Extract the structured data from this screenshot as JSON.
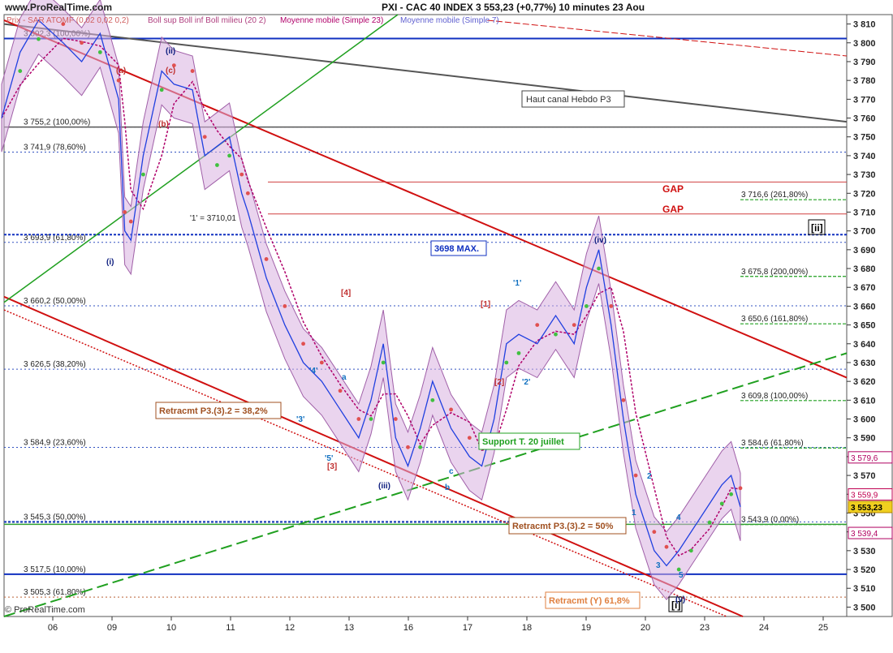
{
  "header": {
    "site": "www.ProRealTime.com",
    "title": "PXI - CAC 40 INDEX      3 553,23 (+0,77%)      10 minutes  23 Aou"
  },
  "legend": [
    {
      "text": "Prix - SAR ATOMF (0,02 0,02 0,2)",
      "color": "#d06060"
    },
    {
      "text": "Boll sup Boll inf Boll milieu (20 2)",
      "color": "#b04080"
    },
    {
      "text": "Moyenne mobile (Simple 23)",
      "color": "#b0006a"
    },
    {
      "text": "Moyenne mobile (Simple 7)",
      "color": "#6060d0"
    }
  ],
  "footer": "© ProRealTime.com",
  "chart_data": {
    "type": "line",
    "ylim": [
      3495,
      3815
    ],
    "y_ticks": [
      3500,
      3510,
      3520,
      3530,
      3540,
      3550,
      3560,
      3570,
      3580,
      3590,
      3600,
      3610,
      3620,
      3630,
      3640,
      3650,
      3660,
      3670,
      3680,
      3690,
      3700,
      3710,
      3720,
      3730,
      3740,
      3750,
      3760,
      3770,
      3780,
      3790,
      3800,
      3810
    ],
    "x_ticks": [
      "06",
      "09",
      "10",
      "11",
      "12",
      "13",
      "16",
      "17",
      "18",
      "19",
      "20",
      "23",
      "24",
      "25"
    ],
    "price_series": {
      "name": "PXI",
      "points": [
        [
          0.0,
          3760
        ],
        [
          0.3,
          3795
        ],
        [
          0.6,
          3812
        ],
        [
          1.0,
          3800
        ],
        [
          1.3,
          3790
        ],
        [
          1.6,
          3805
        ],
        [
          1.9,
          3770
        ],
        [
          2.0,
          3700
        ],
        [
          2.1,
          3695
        ],
        [
          2.3,
          3740
        ],
        [
          2.6,
          3785
        ],
        [
          2.8,
          3778
        ],
        [
          3.1,
          3775
        ],
        [
          3.3,
          3740
        ],
        [
          3.5,
          3745
        ],
        [
          3.7,
          3750
        ],
        [
          3.9,
          3720
        ],
        [
          4.0,
          3710
        ],
        [
          4.3,
          3675
        ],
        [
          4.6,
          3650
        ],
        [
          4.9,
          3630
        ],
        [
          5.2,
          3620
        ],
        [
          5.5,
          3605
        ],
        [
          5.8,
          3590
        ],
        [
          6.0,
          3610
        ],
        [
          6.2,
          3640
        ],
        [
          6.4,
          3590
        ],
        [
          6.6,
          3575
        ],
        [
          6.8,
          3595
        ],
        [
          7.0,
          3620
        ],
        [
          7.3,
          3595
        ],
        [
          7.6,
          3580
        ],
        [
          7.8,
          3575
        ],
        [
          8.0,
          3600
        ],
        [
          8.2,
          3640
        ],
        [
          8.4,
          3645
        ],
        [
          8.7,
          3640
        ],
        [
          9.0,
          3655
        ],
        [
          9.3,
          3640
        ],
        [
          9.5,
          3670
        ],
        [
          9.7,
          3690
        ],
        [
          9.9,
          3650
        ],
        [
          10.1,
          3600
        ],
        [
          10.3,
          3560
        ],
        [
          10.6,
          3530
        ],
        [
          10.8,
          3522
        ],
        [
          11.0,
          3530
        ],
        [
          11.2,
          3540
        ],
        [
          11.5,
          3555
        ],
        [
          11.7,
          3565
        ],
        [
          11.85,
          3570
        ],
        [
          12.0,
          3553.23
        ]
      ]
    },
    "current_price": "3 553,23",
    "right_labels": [
      {
        "text": "3 579,6",
        "y": 3579.6,
        "color": "#b00060"
      },
      {
        "text": "3 559,9",
        "y": 3559.9,
        "color": "#c00050"
      },
      {
        "text": "3 553,23",
        "y": 3553.23,
        "color": "#b08000"
      },
      {
        "text": "3 539,4",
        "y": 3539.4,
        "color": "#b00060"
      }
    ],
    "fib_levels": [
      {
        "label": "3 802,3 (100,00%)",
        "y": 3802.3,
        "side": "left"
      },
      {
        "label": "3 755,2 (100,00%)",
        "y": 3755.2,
        "side": "left"
      },
      {
        "label": "3 741,9 (78,60%)",
        "y": 3741.9,
        "side": "left"
      },
      {
        "label": "3 693,9 (61,80%)",
        "y": 3693.9,
        "side": "left"
      },
      {
        "label": "3 660,2 (50,00%)",
        "y": 3660.2,
        "side": "left"
      },
      {
        "label": "3 626,5 (38,20%)",
        "y": 3626.5,
        "side": "left"
      },
      {
        "label": "3 584,9 (23,60%)",
        "y": 3584.9,
        "side": "left"
      },
      {
        "label": "3 545,3 (50,00%)",
        "y": 3545.3,
        "side": "left"
      },
      {
        "label": "3 517,5 (10,00%)",
        "y": 3517.5,
        "side": "left"
      },
      {
        "label": "3 505,3 (61,80%)",
        "y": 3505.3,
        "side": "left"
      },
      {
        "label": "3 716,6 (261,80%)",
        "y": 3716.6,
        "side": "right"
      },
      {
        "label": "3 675,8 (200,00%)",
        "y": 3675.8,
        "side": "right"
      },
      {
        "label": "3 650,6 (161,80%)",
        "y": 3650.6,
        "side": "right"
      },
      {
        "label": "3 609,8 (100,00%)",
        "y": 3609.8,
        "side": "right"
      },
      {
        "label": "3 584,6 (61,80%)",
        "y": 3584.6,
        "side": "right"
      },
      {
        "label": "3 543,9 (0,00%)",
        "y": 3543.9,
        "side": "right"
      }
    ],
    "annotations": {
      "haut_canal": "Haut canal Hebdo P3",
      "gap1": "GAP",
      "gap2": "GAP",
      "max_box": "3698 MAX.",
      "retr_382": "Retracmt P3.(3).2 = 38,2%",
      "retr_50": "Retracmt P3.(3).2 = 50%",
      "support": "Support T. 20 juillet",
      "retr_y": "Retracmt (Y) 61,8%",
      "level_1": "'1' = 3710,01",
      "wave_ii_big": "[ii]",
      "wave_i_big": "[i]"
    },
    "wave_labels": [
      "(i)",
      "(ii)",
      "(iii)",
      "(iv)",
      "(v)",
      "(a)",
      "(b)",
      "(c)",
      "[1]",
      "[2]",
      "[3]",
      "[4]",
      "'1'",
      "'2'",
      "'3'",
      "'4'",
      "'5'",
      "a",
      "b",
      "c",
      "1",
      "2",
      "3",
      "4",
      "5"
    ]
  }
}
